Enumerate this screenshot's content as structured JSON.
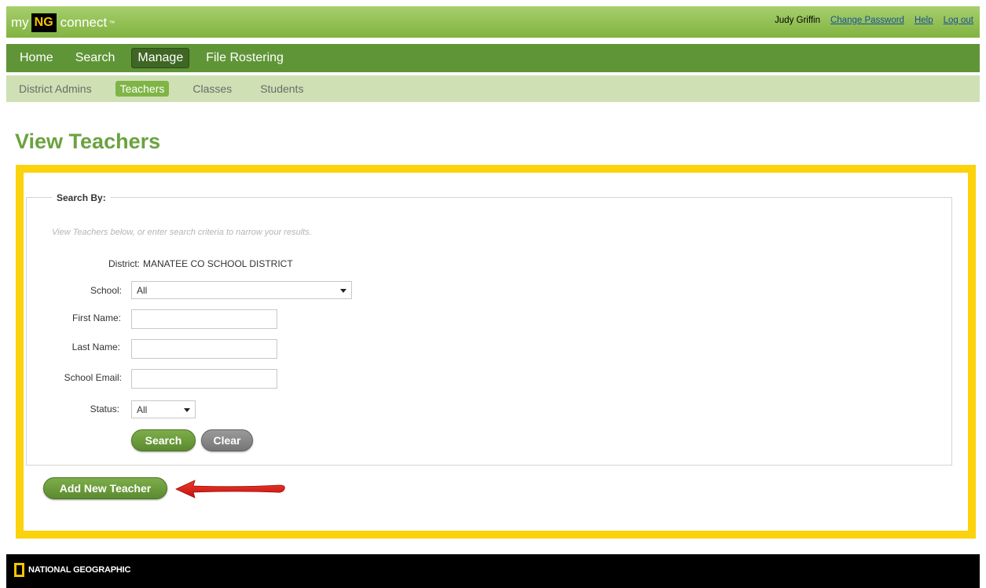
{
  "brand": {
    "my": "my",
    "ng": "NG",
    "connect": "connect",
    "tm": "™"
  },
  "user": {
    "name": "Judy Griffin",
    "change_password": "Change Password",
    "help": "Help",
    "logout": "Log out"
  },
  "main_nav": [
    {
      "label": "Home"
    },
    {
      "label": "Search"
    },
    {
      "label": "Manage",
      "active": true
    },
    {
      "label": "File Rostering"
    }
  ],
  "sub_nav": [
    {
      "label": "District Admins"
    },
    {
      "label": "Teachers",
      "active": true
    },
    {
      "label": "Classes"
    },
    {
      "label": "Students"
    }
  ],
  "page_title": "View Teachers",
  "search": {
    "legend": "Search By:",
    "hint": "View Teachers below, or enter search criteria to narrow your results.",
    "district_label": "District:",
    "district_value": "MANATEE CO SCHOOL DISTRICT",
    "school_label": "School:",
    "school_value": "All",
    "first_name_label": "First Name:",
    "first_name_value": "",
    "last_name_label": "Last Name:",
    "last_name_value": "",
    "email_label": "School Email:",
    "email_value": "",
    "status_label": "Status:",
    "status_value": "All",
    "search_button": "Search",
    "clear_button": "Clear"
  },
  "add_button": "Add New Teacher",
  "footer": {
    "brand": "NATIONAL GEOGRAPHIC"
  },
  "colors": {
    "accent_green": "#6ba23f",
    "highlight_yellow": "#fbd20c",
    "arrow_red": "#e0201b"
  }
}
